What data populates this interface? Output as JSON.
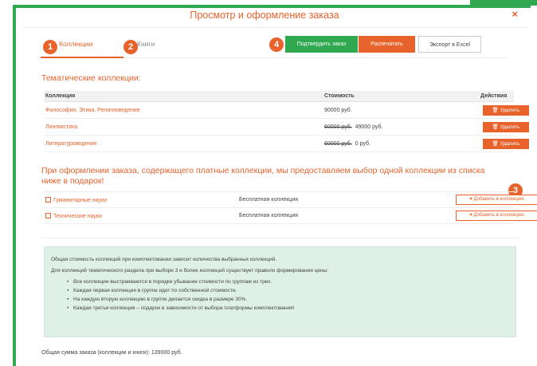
{
  "dialog": {
    "title": "Просмотр и оформление заказа",
    "close_glyph": "×"
  },
  "badges": [
    "1",
    "2",
    "3",
    "4"
  ],
  "tabs": [
    {
      "label": "Коллекции"
    },
    {
      "label": "Книги"
    }
  ],
  "actions": {
    "confirm_label": "Подтвердить заказ",
    "print_label": "Распечатать",
    "export_label": "Экспорт в Excel"
  },
  "collections": {
    "title": "Тематические коллекции:",
    "columns": [
      "Коллекция",
      "Стоимость",
      "Действия"
    ],
    "rows": [
      {
        "name": "Философия. Этика. Религиоведение",
        "old_price": "",
        "price": "90000 руб.",
        "action": "Удалить"
      },
      {
        "name": "Лингвистика",
        "old_price": "60000 руб.",
        "price": "49000 руб.",
        "action": "Удалить"
      },
      {
        "name": "Литературоведение",
        "old_price": "60000 руб.",
        "price": "0 руб.",
        "action": "Удалить"
      }
    ]
  },
  "gift": {
    "note": "При оформлении заказа, содержащего платные коллекции, мы предоставляем выбор одной коллекции из списка ниже в подарок!",
    "rows": [
      {
        "name": "Гуманитарные науки",
        "type": "Бесплатная коллекция",
        "action": "Добавить в коллекцию"
      },
      {
        "name": "Технические науки",
        "type": "Бесплатная коллекция",
        "action": "Добавить в коллекцию"
      }
    ]
  },
  "info": {
    "line1": "Общая стоимость коллекций при комплектовании зависит количества выбранных коллекций.",
    "line2": "Для коллекций тематического раздела при выборе 3 и более коллекций существует правило формирования цены:",
    "bullets": [
      "Все коллекции выстраиваются в порядке убывания стоимости по группам из трех.",
      "Каждая первая коллекция в группе идет по собственной стоимости.",
      "На каждую вторую коллекцию в группе делается скидка в размере 30%.",
      "Каждая третья коллекция – подарок в зависимости от выбора платформы комплектования!"
    ]
  },
  "total": "Общая сумма заказа (коллекции и книги): 139000 руб.",
  "colors": {
    "accent": "#e8622c",
    "green": "#2fa84f",
    "info_bg": "#dff0e7"
  }
}
